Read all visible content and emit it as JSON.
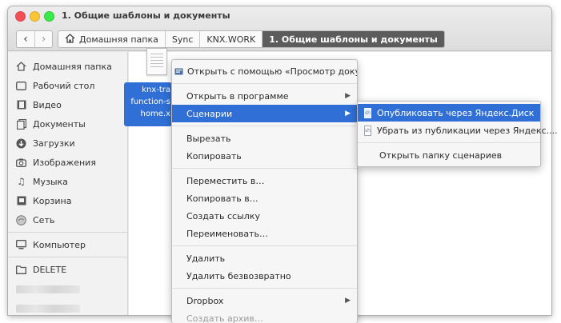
{
  "window": {
    "title": "1. Общие шаблоны и документы"
  },
  "nav": {
    "back_icon": "chevron-left-icon",
    "forward_icon": "chevron-right-icon"
  },
  "breadcrumbs": [
    {
      "label": "Домашняя папка",
      "icon": "home-icon"
    },
    {
      "label": "Sync"
    },
    {
      "label": "KNX.WORK"
    },
    {
      "label": "1. Общие шаблоны и документы",
      "active": true
    }
  ],
  "sidebar": {
    "items": [
      {
        "label": "Домашняя папка",
        "icon": "home-icon"
      },
      {
        "label": "Рабочий стол",
        "icon": "desktop-icon"
      },
      {
        "label": "Видео",
        "icon": "video-icon"
      },
      {
        "label": "Документы",
        "icon": "documents-icon"
      },
      {
        "label": "Загрузки",
        "icon": "downloads-icon"
      },
      {
        "label": "Изображения",
        "icon": "camera-icon"
      },
      {
        "label": "Музыка",
        "icon": "music-icon"
      },
      {
        "label": "Корзина",
        "icon": "trash-icon"
      },
      {
        "label": "Сеть",
        "icon": "network-icon"
      }
    ],
    "computer": {
      "label": "Компьютер",
      "icon": "computer-icon"
    },
    "bookmarks": [
      {
        "label": "DELETE",
        "icon": "folder-icon"
      }
    ]
  },
  "file": {
    "label_lines": [
      "knx-tra",
      "function-s",
      "home.x"
    ],
    "icon": "document-thumbnail-icon"
  },
  "context_menu": {
    "items": [
      {
        "label": "Открыть с помощью «Просмотр доку…",
        "icon": "document-viewer-icon"
      },
      {
        "type": "separator"
      },
      {
        "label": "Открыть в программе",
        "submenu": true
      },
      {
        "label": "Сценарии",
        "submenu": true,
        "highlighted": true
      },
      {
        "type": "separator"
      },
      {
        "label": "Вырезать"
      },
      {
        "label": "Копировать"
      },
      {
        "type": "separator"
      },
      {
        "label": "Переместить в…"
      },
      {
        "label": "Копировать в…"
      },
      {
        "label": "Создать ссылку"
      },
      {
        "label": "Переименовать…"
      },
      {
        "type": "separator"
      },
      {
        "label": "Удалить"
      },
      {
        "label": "Удалить безвозвратно"
      },
      {
        "type": "separator"
      },
      {
        "label": "Dropbox",
        "submenu": true
      },
      {
        "label": "Создать архив…",
        "partial": true
      }
    ]
  },
  "scripts_submenu": {
    "items": [
      {
        "label": "Опубликовать через Яндекс.Диск",
        "icon": "script-icon",
        "highlighted": true
      },
      {
        "label": "Убрать из публикации через Яндекс....",
        "icon": "script-icon"
      },
      {
        "type": "separator"
      },
      {
        "label": "Открыть папку сценариев"
      }
    ]
  },
  "colors": {
    "accent": "#2f6fd6",
    "active_crumb": "#5c5c5c",
    "close": "#f25056",
    "minimize": "#fac536",
    "maximize": "#39ea49"
  }
}
